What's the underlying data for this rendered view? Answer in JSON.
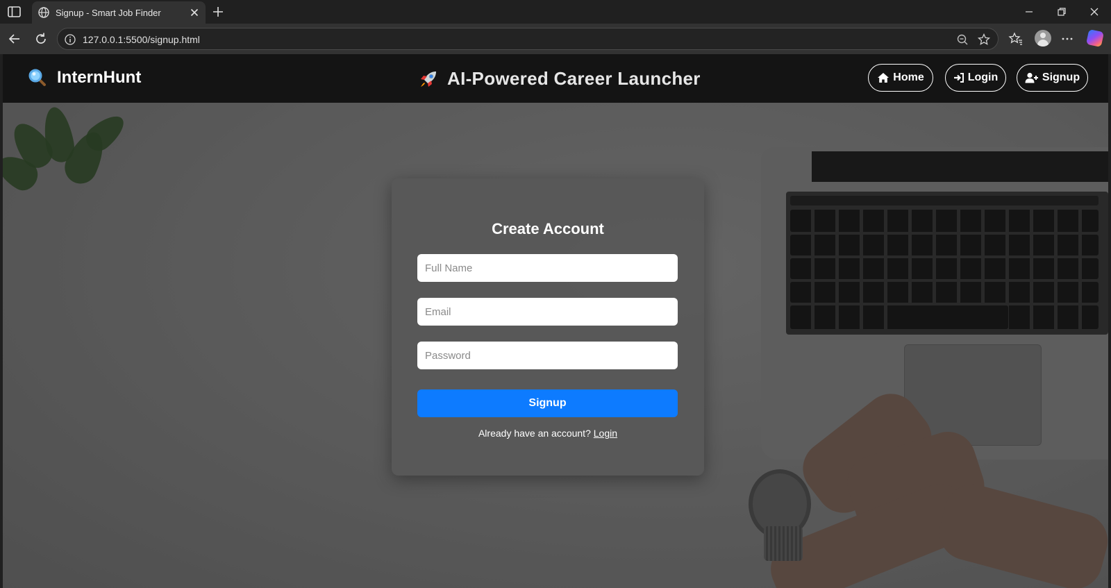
{
  "browser": {
    "tab_title": "Signup - Smart Job Finder",
    "url": "127.0.0.1:5500/signup.html"
  },
  "site": {
    "brand": "InternHunt",
    "tagline": "AI-Powered Career Launcher",
    "nav": {
      "home": "Home",
      "login": "Login",
      "signup": "Signup"
    }
  },
  "form": {
    "title": "Create Account",
    "full_name_placeholder": "Full Name",
    "email_placeholder": "Email",
    "password_placeholder": "Password",
    "submit_label": "Signup",
    "switch_prompt": "Already have an account?",
    "switch_link": "Login"
  },
  "colors": {
    "accent": "#0d7bff",
    "nav_background": "#141414",
    "card_background": "#585858"
  }
}
